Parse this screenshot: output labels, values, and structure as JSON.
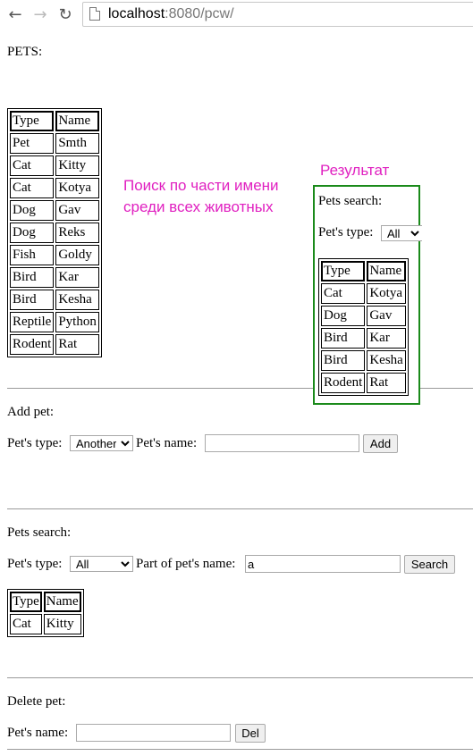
{
  "browser": {
    "url_host": "localhost",
    "url_rest": ":8080/pcw/"
  },
  "page": {
    "heading": "PETS:",
    "pets_table": {
      "headers": [
        "Type",
        "Name"
      ],
      "rows": [
        [
          "Pet",
          "Smth"
        ],
        [
          "Cat",
          "Kitty"
        ],
        [
          "Cat",
          "Kotya"
        ],
        [
          "Dog",
          "Gav"
        ],
        [
          "Dog",
          "Reks"
        ],
        [
          "Fish",
          "Goldy"
        ],
        [
          "Bird",
          "Kar"
        ],
        [
          "Bird",
          "Kesha"
        ],
        [
          "Reptile",
          "Python"
        ],
        [
          "Rodent",
          "Rat"
        ]
      ]
    },
    "annotation": {
      "line1": "Поиск по части имени",
      "line2": "среди всех животных",
      "result_label": "Результат"
    },
    "result_panel": {
      "title": "Pets search:",
      "type_label": "Pet's type:",
      "type_value": "All",
      "headers": [
        "Type",
        "Name"
      ],
      "rows": [
        [
          "Cat",
          "Kotya"
        ],
        [
          "Dog",
          "Gav"
        ],
        [
          "Bird",
          "Kar"
        ],
        [
          "Bird",
          "Kesha"
        ],
        [
          "Rodent",
          "Rat"
        ]
      ]
    },
    "add_pet": {
      "title": "Add pet:",
      "type_label": "Pet's type:",
      "type_value": "Another",
      "name_label": "Pet's name:",
      "name_value": "",
      "button": "Add"
    },
    "search": {
      "title": "Pets search:",
      "type_label": "Pet's type:",
      "type_value": "All",
      "part_label": "Part of pet's name:",
      "part_value": "a",
      "button": "Search",
      "headers": [
        "Type",
        "Name"
      ],
      "rows": [
        [
          "Cat",
          "Kitty"
        ]
      ]
    },
    "delete_pet": {
      "title": "Delete pet:",
      "name_label": "Pet's name:",
      "name_value": "",
      "button": "Del"
    },
    "colors": {
      "annotation": "#e020c0",
      "result_border": "#1a8a1a"
    }
  }
}
